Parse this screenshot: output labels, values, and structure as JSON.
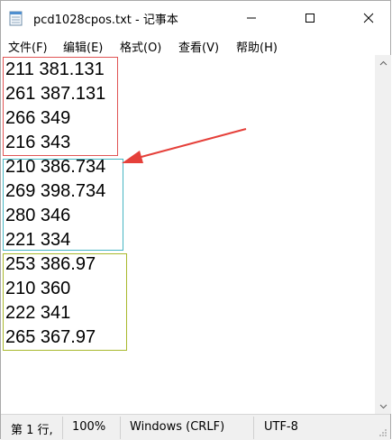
{
  "window": {
    "title": "pcd1028cpos.txt - 记事本"
  },
  "menu": {
    "items": [
      "文件(F)",
      "编辑(E)",
      "格式(O)",
      "查看(V)",
      "帮助(H)"
    ]
  },
  "editor": {
    "lines": [
      "211 381.131",
      "261 387.131",
      "266 349",
      "216 343",
      "210 386.734",
      "269 398.734",
      "280 346",
      "221 334",
      "253 386.97",
      "210 360",
      "222 341",
      "265 367.97"
    ]
  },
  "annotations": {
    "box_colors": [
      "#e05555",
      "#46b6c2",
      "#a9b92d"
    ],
    "arrow_color": "#e5403a"
  },
  "status": {
    "position": "第 1 行,",
    "zoom": "100%",
    "line_ending": "Windows (CRLF)",
    "encoding": "UTF-8"
  }
}
